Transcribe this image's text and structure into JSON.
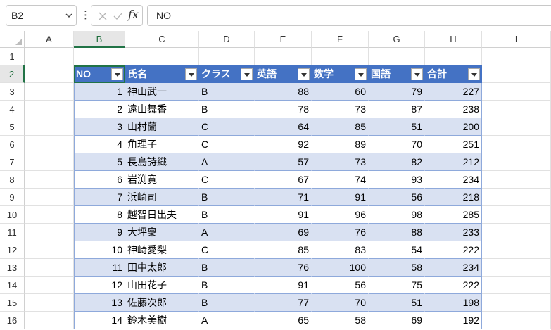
{
  "formula_bar": {
    "name_box": "B2",
    "formula": "NO",
    "fx_label": "fx",
    "more_glyph": "⋮"
  },
  "columns": [
    "A",
    "B",
    "C",
    "D",
    "E",
    "F",
    "G",
    "H",
    "I"
  ],
  "selected_column": "B",
  "rows": [
    "1",
    "2",
    "3",
    "4",
    "5",
    "6",
    "7",
    "8",
    "9",
    "10",
    "11",
    "12",
    "13",
    "14",
    "15",
    "16"
  ],
  "selected_row": "2",
  "table": {
    "headers": [
      "NO",
      "氏名",
      "クラス",
      "英語",
      "数学",
      "国語",
      "合計"
    ],
    "records": [
      [
        "1",
        "神山武一",
        "B",
        "88",
        "60",
        "79",
        "227"
      ],
      [
        "2",
        "遠山舞香",
        "B",
        "78",
        "73",
        "87",
        "238"
      ],
      [
        "3",
        "山村蘭",
        "C",
        "64",
        "85",
        "51",
        "200"
      ],
      [
        "4",
        "角理子",
        "C",
        "92",
        "89",
        "70",
        "251"
      ],
      [
        "5",
        "長島詩織",
        "A",
        "57",
        "73",
        "82",
        "212"
      ],
      [
        "6",
        "岩渕寛",
        "C",
        "67",
        "74",
        "93",
        "234"
      ],
      [
        "7",
        "浜崎司",
        "B",
        "71",
        "91",
        "56",
        "218"
      ],
      [
        "8",
        "越智日出夫",
        "B",
        "91",
        "96",
        "98",
        "285"
      ],
      [
        "9",
        "大坪稟",
        "A",
        "69",
        "76",
        "88",
        "233"
      ],
      [
        "10",
        "神崎愛梨",
        "C",
        "85",
        "83",
        "54",
        "222"
      ],
      [
        "11",
        "田中太郎",
        "B",
        "76",
        "100",
        "58",
        "234"
      ],
      [
        "12",
        "山田花子",
        "B",
        "91",
        "56",
        "75",
        "222"
      ],
      [
        "13",
        "佐藤次郎",
        "B",
        "77",
        "70",
        "51",
        "198"
      ],
      [
        "14",
        "鈴木美樹",
        "A",
        "65",
        "58",
        "69",
        "192"
      ]
    ]
  },
  "colors": {
    "header_fill": "#4472c4",
    "band_fill": "#d9e1f2",
    "selection": "#217346"
  }
}
